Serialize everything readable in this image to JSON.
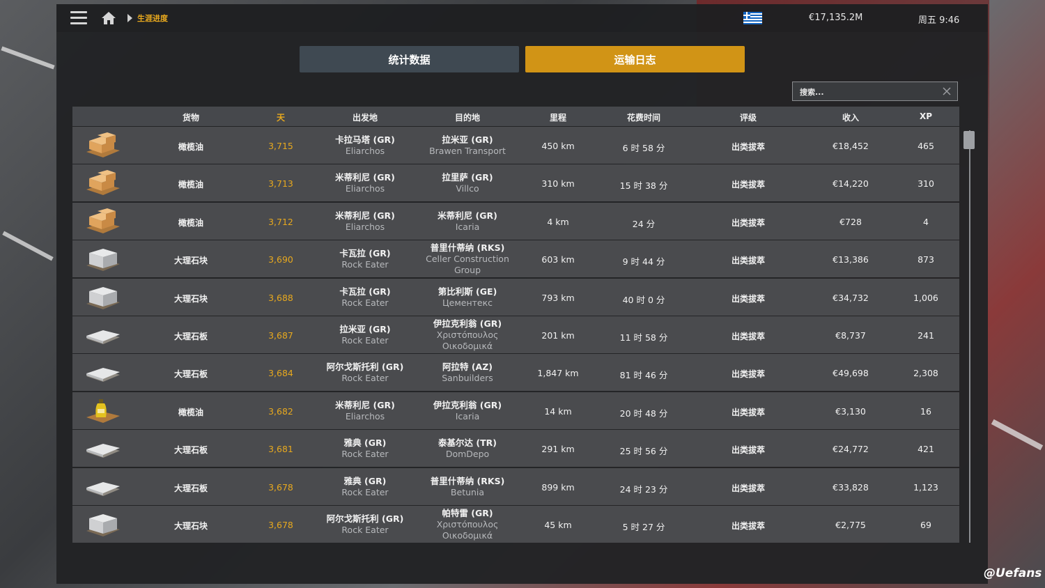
{
  "header": {
    "breadcrumb": "生涯进度",
    "money": "€17,135.2M",
    "clock": "周五 9:46",
    "flag": "greece-flag"
  },
  "tabs": {
    "stats": "统计数据",
    "log": "运输日志"
  },
  "search": {
    "placeholder": "搜索..."
  },
  "columns": {
    "cargo": "货物",
    "day": "天",
    "origin": "出发地",
    "destination": "目的地",
    "distance": "里程",
    "time": "花费时间",
    "rating": "评级",
    "income": "收入",
    "xp": "XP"
  },
  "rows": [
    {
      "icon": "crate-pallet-icon",
      "cargo": "橄榄油",
      "day": "3,715",
      "origin": "卡拉马塔 (GR)",
      "origin_company": "Eliarchos",
      "dest": "拉米亚 (GR)",
      "dest_company": "Brawen Transport",
      "distance": "450 km",
      "time": "6 时 58 分",
      "rating": "出类拔萃",
      "income": "€18,452",
      "xp": "465"
    },
    {
      "icon": "crate-pallet-icon",
      "cargo": "橄榄油",
      "day": "3,713",
      "origin": "米蒂利尼 (GR)",
      "origin_company": "Eliarchos",
      "dest": "拉里萨 (GR)",
      "dest_company": "Villco",
      "distance": "310 km",
      "time": "15 时 38 分",
      "rating": "出类拔萃",
      "income": "€14,220",
      "xp": "310"
    },
    {
      "icon": "crate-pallet-icon",
      "cargo": "橄榄油",
      "day": "3,712",
      "origin": "米蒂利尼 (GR)",
      "origin_company": "Eliarchos",
      "dest": "米蒂利尼 (GR)",
      "dest_company": "Icaria",
      "distance": "4 km",
      "time": "24 分",
      "rating": "出类拔萃",
      "income": "€728",
      "xp": "4"
    },
    {
      "icon": "marble-block-icon",
      "cargo": "大理石块",
      "day": "3,690",
      "origin": "卡瓦拉 (GR)",
      "origin_company": "Rock Eater",
      "dest": "普里什蒂纳 (RKS)",
      "dest_company": "Celler Construction Group",
      "distance": "603 km",
      "time": "9 时 44 分",
      "rating": "出类拔萃",
      "income": "€13,386",
      "xp": "873"
    },
    {
      "icon": "marble-block-icon",
      "cargo": "大理石块",
      "day": "3,688",
      "origin": "卡瓦拉 (GR)",
      "origin_company": "Rock Eater",
      "dest": "第比利斯 (GE)",
      "dest_company": "Цементекс",
      "distance": "793 km",
      "time": "40 时 0 分",
      "rating": "出类拔萃",
      "income": "€34,732",
      "xp": "1,006"
    },
    {
      "icon": "marble-slab-icon",
      "cargo": "大理石板",
      "day": "3,687",
      "origin": "拉米亚 (GR)",
      "origin_company": "Rock Eater",
      "dest": "伊拉克利翁 (GR)",
      "dest_company": "Χριστόπουλος Οικοδομικά",
      "distance": "201 km",
      "time": "11 时 58 分",
      "rating": "出类拔萃",
      "income": "€8,737",
      "xp": "241"
    },
    {
      "icon": "marble-slab-icon",
      "cargo": "大理石板",
      "day": "3,684",
      "origin": "阿尔戈斯托利 (GR)",
      "origin_company": "Rock Eater",
      "dest": "阿拉特 (AZ)",
      "dest_company": "Sanbuilders",
      "distance": "1,847 km",
      "time": "81 时 46 分",
      "rating": "出类拔萃",
      "income": "€49,698",
      "xp": "2,308"
    },
    {
      "icon": "olive-oil-bottle-icon",
      "cargo": "橄榄油",
      "day": "3,682",
      "origin": "米蒂利尼 (GR)",
      "origin_company": "Eliarchos",
      "dest": "伊拉克利翁 (GR)",
      "dest_company": "Icaria",
      "distance": "14 km",
      "time": "20 时 48 分",
      "rating": "出类拔萃",
      "income": "€3,130",
      "xp": "16"
    },
    {
      "icon": "marble-slab-icon",
      "cargo": "大理石板",
      "day": "3,681",
      "origin": "雅典 (GR)",
      "origin_company": "Rock Eater",
      "dest": "泰基尔达 (TR)",
      "dest_company": "DomDepo",
      "distance": "291 km",
      "time": "25 时 56 分",
      "rating": "出类拔萃",
      "income": "€24,772",
      "xp": "421"
    },
    {
      "icon": "marble-slab-icon",
      "cargo": "大理石板",
      "day": "3,678",
      "origin": "雅典 (GR)",
      "origin_company": "Rock Eater",
      "dest": "普里什蒂纳 (RKS)",
      "dest_company": "Betunia",
      "distance": "899 km",
      "time": "24 时 23 分",
      "rating": "出类拔萃",
      "income": "€33,828",
      "xp": "1,123"
    },
    {
      "icon": "marble-block-icon",
      "cargo": "大理石块",
      "day": "3,678",
      "origin": "阿尔戈斯托利 (GR)",
      "origin_company": "Rock Eater",
      "dest": "帕特雷 (GR)",
      "dest_company": "Χριστόπουλος Οικοδομικά",
      "distance": "45 km",
      "time": "5 时 27 分",
      "rating": "出类拔萃",
      "income": "€2,775",
      "xp": "69"
    }
  ],
  "watermark": "@Uefans",
  "colors": {
    "accent": "#d19416",
    "day": "#e8a91e",
    "tab_inactive": "#3f4952"
  }
}
